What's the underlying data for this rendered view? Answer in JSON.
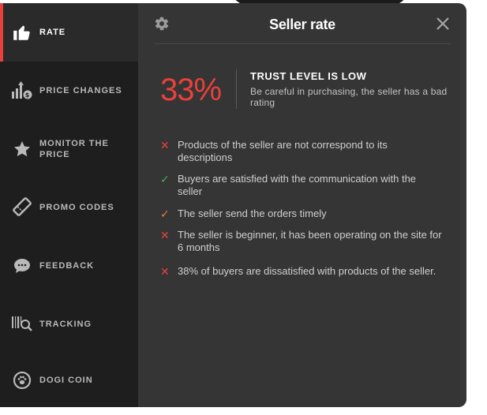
{
  "sidebar": {
    "items": [
      {
        "label": "RATE",
        "icon": "thumbs-up-icon",
        "active": true
      },
      {
        "label": "PRICE CHANGES",
        "icon": "price-chart-icon"
      },
      {
        "label": "MONITOR THE PRICE",
        "icon": "star-icon"
      },
      {
        "label": "PROMO CODES",
        "icon": "ticket-icon"
      },
      {
        "label": "FEEDBACK",
        "icon": "chat-bubble-icon"
      },
      {
        "label": "TRACKING",
        "icon": "barcode-search-icon"
      },
      {
        "label": "DOGI COIN",
        "icon": "paw-coin-icon"
      }
    ]
  },
  "header": {
    "title": "Seller rate",
    "settings_icon": "gear-icon",
    "close_icon": "close-icon"
  },
  "rating": {
    "percent": "33%",
    "trust_title": "TRUST LEVEL IS LOW",
    "trust_desc": "Be careful in purchasing, the seller has a bad rating"
  },
  "points": [
    {
      "status": "negative",
      "text": "Products of the seller are not correspond to its descriptions"
    },
    {
      "status": "positive",
      "text": "Buyers are satisfied with the communication with the seller"
    },
    {
      "status": "neutral",
      "text": "The seller send the orders timely"
    },
    {
      "status": "negative",
      "text": "The seller is beginner, it has been operating on the site for 6 months"
    },
    {
      "status": "negative",
      "text": "38% of buyers are dissatisfied with products of the seller."
    }
  ],
  "colors": {
    "accent_red": "#e8413b",
    "positive_green": "#4caf50",
    "neutral_orange": "#ef7a3c",
    "panel_bg": "#353535",
    "sidebar_bg": "#1e1e1e"
  }
}
